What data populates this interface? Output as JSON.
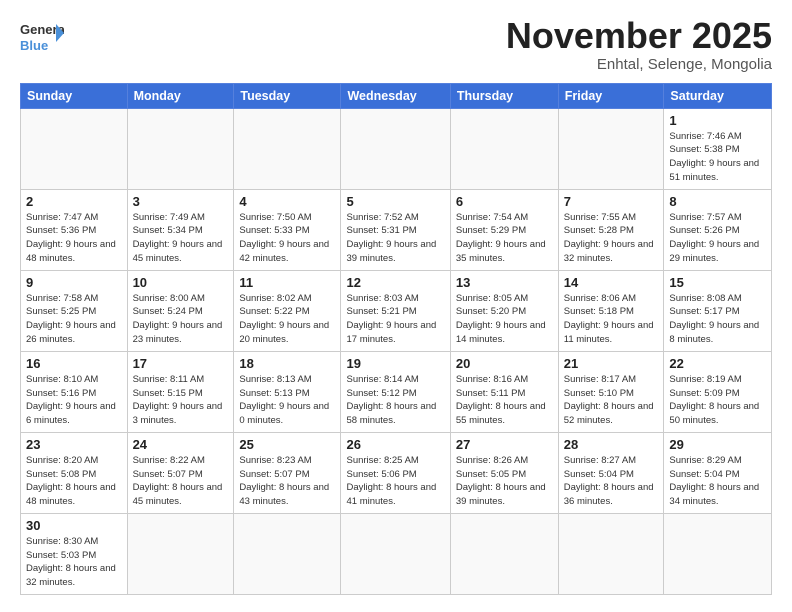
{
  "header": {
    "logo_general": "General",
    "logo_blue": "Blue",
    "month": "November 2025",
    "location": "Enhtal, Selenge, Mongolia"
  },
  "days_of_week": [
    "Sunday",
    "Monday",
    "Tuesday",
    "Wednesday",
    "Thursday",
    "Friday",
    "Saturday"
  ],
  "weeks": [
    [
      {
        "day": "",
        "info": ""
      },
      {
        "day": "",
        "info": ""
      },
      {
        "day": "",
        "info": ""
      },
      {
        "day": "",
        "info": ""
      },
      {
        "day": "",
        "info": ""
      },
      {
        "day": "",
        "info": ""
      },
      {
        "day": "1",
        "info": "Sunrise: 7:46 AM\nSunset: 5:38 PM\nDaylight: 9 hours\nand 51 minutes."
      }
    ],
    [
      {
        "day": "2",
        "info": "Sunrise: 7:47 AM\nSunset: 5:36 PM\nDaylight: 9 hours\nand 48 minutes."
      },
      {
        "day": "3",
        "info": "Sunrise: 7:49 AM\nSunset: 5:34 PM\nDaylight: 9 hours\nand 45 minutes."
      },
      {
        "day": "4",
        "info": "Sunrise: 7:50 AM\nSunset: 5:33 PM\nDaylight: 9 hours\nand 42 minutes."
      },
      {
        "day": "5",
        "info": "Sunrise: 7:52 AM\nSunset: 5:31 PM\nDaylight: 9 hours\nand 39 minutes."
      },
      {
        "day": "6",
        "info": "Sunrise: 7:54 AM\nSunset: 5:29 PM\nDaylight: 9 hours\nand 35 minutes."
      },
      {
        "day": "7",
        "info": "Sunrise: 7:55 AM\nSunset: 5:28 PM\nDaylight: 9 hours\nand 32 minutes."
      },
      {
        "day": "8",
        "info": "Sunrise: 7:57 AM\nSunset: 5:26 PM\nDaylight: 9 hours\nand 29 minutes."
      }
    ],
    [
      {
        "day": "9",
        "info": "Sunrise: 7:58 AM\nSunset: 5:25 PM\nDaylight: 9 hours\nand 26 minutes."
      },
      {
        "day": "10",
        "info": "Sunrise: 8:00 AM\nSunset: 5:24 PM\nDaylight: 9 hours\nand 23 minutes."
      },
      {
        "day": "11",
        "info": "Sunrise: 8:02 AM\nSunset: 5:22 PM\nDaylight: 9 hours\nand 20 minutes."
      },
      {
        "day": "12",
        "info": "Sunrise: 8:03 AM\nSunset: 5:21 PM\nDaylight: 9 hours\nand 17 minutes."
      },
      {
        "day": "13",
        "info": "Sunrise: 8:05 AM\nSunset: 5:20 PM\nDaylight: 9 hours\nand 14 minutes."
      },
      {
        "day": "14",
        "info": "Sunrise: 8:06 AM\nSunset: 5:18 PM\nDaylight: 9 hours\nand 11 minutes."
      },
      {
        "day": "15",
        "info": "Sunrise: 8:08 AM\nSunset: 5:17 PM\nDaylight: 9 hours\nand 8 minutes."
      }
    ],
    [
      {
        "day": "16",
        "info": "Sunrise: 8:10 AM\nSunset: 5:16 PM\nDaylight: 9 hours\nand 6 minutes."
      },
      {
        "day": "17",
        "info": "Sunrise: 8:11 AM\nSunset: 5:15 PM\nDaylight: 9 hours\nand 3 minutes."
      },
      {
        "day": "18",
        "info": "Sunrise: 8:13 AM\nSunset: 5:13 PM\nDaylight: 9 hours\nand 0 minutes."
      },
      {
        "day": "19",
        "info": "Sunrise: 8:14 AM\nSunset: 5:12 PM\nDaylight: 8 hours\nand 58 minutes."
      },
      {
        "day": "20",
        "info": "Sunrise: 8:16 AM\nSunset: 5:11 PM\nDaylight: 8 hours\nand 55 minutes."
      },
      {
        "day": "21",
        "info": "Sunrise: 8:17 AM\nSunset: 5:10 PM\nDaylight: 8 hours\nand 52 minutes."
      },
      {
        "day": "22",
        "info": "Sunrise: 8:19 AM\nSunset: 5:09 PM\nDaylight: 8 hours\nand 50 minutes."
      }
    ],
    [
      {
        "day": "23",
        "info": "Sunrise: 8:20 AM\nSunset: 5:08 PM\nDaylight: 8 hours\nand 48 minutes."
      },
      {
        "day": "24",
        "info": "Sunrise: 8:22 AM\nSunset: 5:07 PM\nDaylight: 8 hours\nand 45 minutes."
      },
      {
        "day": "25",
        "info": "Sunrise: 8:23 AM\nSunset: 5:07 PM\nDaylight: 8 hours\nand 43 minutes."
      },
      {
        "day": "26",
        "info": "Sunrise: 8:25 AM\nSunset: 5:06 PM\nDaylight: 8 hours\nand 41 minutes."
      },
      {
        "day": "27",
        "info": "Sunrise: 8:26 AM\nSunset: 5:05 PM\nDaylight: 8 hours\nand 39 minutes."
      },
      {
        "day": "28",
        "info": "Sunrise: 8:27 AM\nSunset: 5:04 PM\nDaylight: 8 hours\nand 36 minutes."
      },
      {
        "day": "29",
        "info": "Sunrise: 8:29 AM\nSunset: 5:04 PM\nDaylight: 8 hours\nand 34 minutes."
      }
    ],
    [
      {
        "day": "30",
        "info": "Sunrise: 8:30 AM\nSunset: 5:03 PM\nDaylight: 8 hours\nand 32 minutes."
      },
      {
        "day": "",
        "info": ""
      },
      {
        "day": "",
        "info": ""
      },
      {
        "day": "",
        "info": ""
      },
      {
        "day": "",
        "info": ""
      },
      {
        "day": "",
        "info": ""
      },
      {
        "day": "",
        "info": ""
      }
    ]
  ]
}
